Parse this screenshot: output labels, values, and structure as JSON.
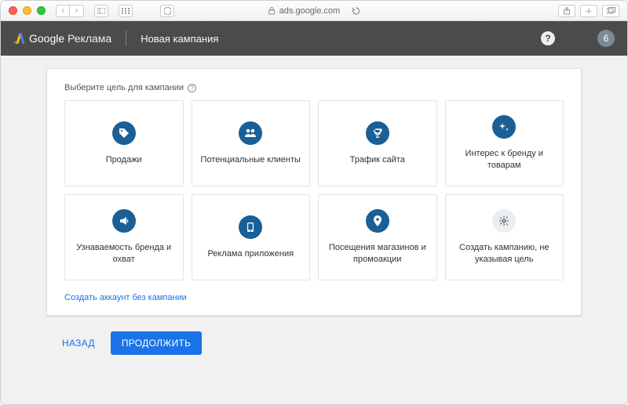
{
  "browser": {
    "url": "ads.google.com"
  },
  "header": {
    "brand_primary": "Google",
    "brand_secondary": "Реклама",
    "page_title": "Новая кампания",
    "avatar_initial": "6"
  },
  "section_label": "Выберите цель для кампании",
  "goals": [
    {
      "key": "sales",
      "label": "Продажи"
    },
    {
      "key": "leads",
      "label": "Потенциальные клиенты"
    },
    {
      "key": "traffic",
      "label": "Трафик сайта"
    },
    {
      "key": "brand-interest",
      "label": "Интерес к бренду и товарам"
    },
    {
      "key": "awareness",
      "label": "Узнаваемость бренда и охват"
    },
    {
      "key": "app-promo",
      "label": "Реклама приложения"
    },
    {
      "key": "store-visits",
      "label": "Посещения магазинов и промоакции"
    },
    {
      "key": "no-goal",
      "label": "Создать кампанию, не указывая цель"
    }
  ],
  "link_no_campaign": "Создать аккаунт без кампании",
  "buttons": {
    "back": "НАЗАД",
    "continue": "ПРОДОЛЖИТЬ"
  },
  "colors": {
    "header_bg": "#4b4b4b",
    "primary_blue": "#1a73e8",
    "icon_blue": "#1a5f95",
    "page_bg": "#f1f1f1"
  }
}
